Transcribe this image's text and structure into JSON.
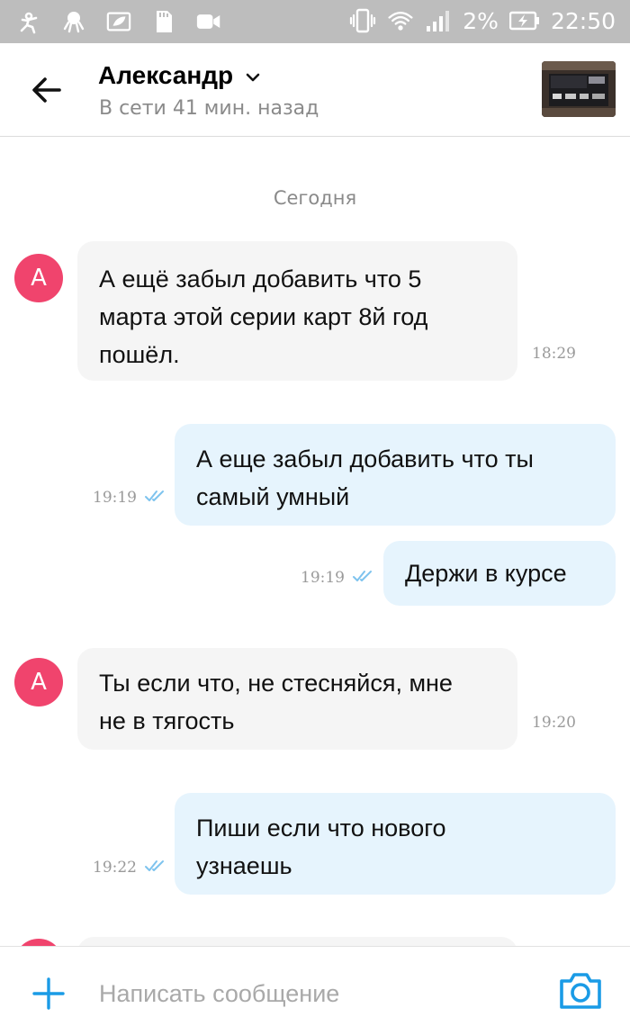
{
  "status_bar": {
    "battery": "2%",
    "time": "22:50",
    "left_icons": [
      "app-notification-icon",
      "octopus-icon",
      "leaf-icon",
      "sd-card-icon",
      "video-camera-icon"
    ],
    "right_icons": [
      "vibrate-icon",
      "wifi-icon",
      "signal-icon",
      "battery-charging-icon"
    ]
  },
  "header": {
    "name": "Александр",
    "status": "В сети 41 мин. назад",
    "back_icon": "arrow-left-icon",
    "chevron_icon": "chevron-down-icon"
  },
  "chat": {
    "date_separator": "Сегодня",
    "messages": [
      {
        "direction": "incoming",
        "avatar_letter": "А",
        "text": "А ещё забыл добавить что 5\nмарта этой серии карт 8й год\nпошёл.",
        "time": "18:29"
      },
      {
        "direction": "outgoing",
        "text": "А еще забыл добавить что ты\nсамый умный",
        "time": "19:19",
        "read": true
      },
      {
        "direction": "outgoing",
        "text": "Держи в курсе",
        "time": "19:19",
        "read": true
      },
      {
        "direction": "incoming",
        "avatar_letter": "А",
        "text": "Ты если что, не стесняйся, мне\nне в тягость",
        "time": "19:20"
      },
      {
        "direction": "outgoing",
        "text": "Пиши если что нового\nузнаешь",
        "time": "19:22",
        "read": true
      }
    ]
  },
  "composer": {
    "placeholder": "Написать сообщение",
    "add_icon": "plus-icon",
    "camera_icon": "camera-icon"
  },
  "colors": {
    "accent": "#1a9be6",
    "avatar": "#f0446d",
    "incoming_bubble": "#f5f5f5",
    "outgoing_bubble": "#e6f4fd",
    "status_bar": "#bdbdbd"
  }
}
